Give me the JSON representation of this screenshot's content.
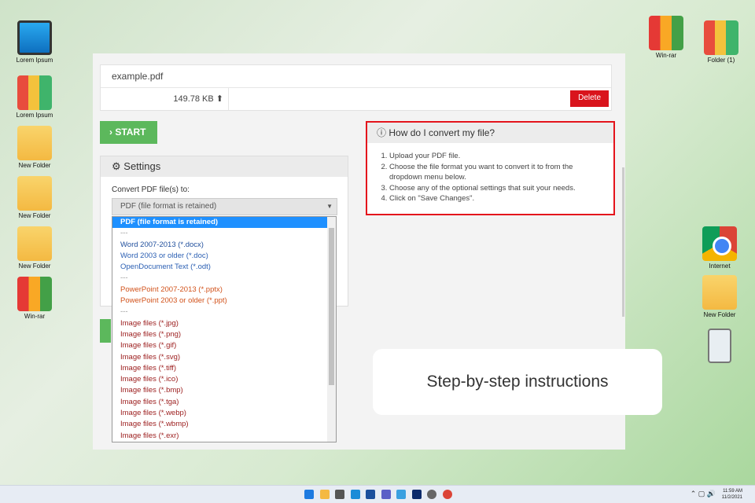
{
  "desktop": {
    "left_icons": [
      {
        "label": "Lorem Ipsum",
        "icon": "computer-icon"
      },
      {
        "label": "Lorem Ipsum",
        "icon": "binders-icon"
      },
      {
        "label": "New Folder",
        "icon": "folder-icon"
      },
      {
        "label": "New Folder",
        "icon": "folder-icon"
      },
      {
        "label": "New Folder",
        "icon": "folder-icon"
      },
      {
        "label": "Win-rar",
        "icon": "winrar-icon"
      }
    ],
    "right_icons": [
      {
        "label": "Win-rar",
        "icon": "winrar-icon"
      },
      {
        "label": "Folder (1)",
        "icon": "binders-icon"
      },
      {
        "label": "Internet",
        "icon": "chrome-icon"
      },
      {
        "label": "New Folder",
        "icon": "folder-icon"
      },
      {
        "label": "",
        "icon": "trash-icon"
      }
    ]
  },
  "file": {
    "name": "example.pdf",
    "size": "149.78 KB",
    "delete_label": "Delete"
  },
  "start_label": "START",
  "settings": {
    "title": "Settings",
    "convert_label": "Convert PDF file(s) to:",
    "selected": "PDF (file format is retained)"
  },
  "help": {
    "title": "How do I convert my file?",
    "steps": [
      "Upload your PDF file.",
      "Choose the file format you want to convert it to from the dropdown menu below.",
      "Choose any of the optional settings that suit your needs.",
      "Click on \"Save Changes\"."
    ]
  },
  "dropdown": {
    "options": [
      {
        "label": "PDF (file format is retained)",
        "color": "#ffffff"
      },
      {
        "label": "---",
        "color": "#999999"
      },
      {
        "label": "Word 2007-2013 (*.docx)",
        "color": "#1f4e9c"
      },
      {
        "label": "Word 2003 or older (*.doc)",
        "color": "#2b5fb3"
      },
      {
        "label": "OpenDocument Text (*.odt)",
        "color": "#2b5fb3"
      },
      {
        "label": "---",
        "color": "#999999"
      },
      {
        "label": "PowerPoint 2007-2013 (*.pptx)",
        "color": "#d2531c"
      },
      {
        "label": "PowerPoint 2003 or older (*.ppt)",
        "color": "#d2531c"
      },
      {
        "label": "---",
        "color": "#999999"
      },
      {
        "label": "Image files (*.jpg)",
        "color": "#9b1c1c"
      },
      {
        "label": "Image files (*.png)",
        "color": "#9b1c1c"
      },
      {
        "label": "Image files (*.gif)",
        "color": "#9b1c1c"
      },
      {
        "label": "Image files (*.svg)",
        "color": "#9b1c1c"
      },
      {
        "label": "Image files (*.tiff)",
        "color": "#9b1c1c"
      },
      {
        "label": "Image files (*.ico)",
        "color": "#9b1c1c"
      },
      {
        "label": "Image files (*.bmp)",
        "color": "#9b1c1c"
      },
      {
        "label": "Image files (*.tga)",
        "color": "#9b1c1c"
      },
      {
        "label": "Image files (*.webp)",
        "color": "#9b1c1c"
      },
      {
        "label": "Image files (*.wbmp)",
        "color": "#9b1c1c"
      },
      {
        "label": "Image files (*.exr)",
        "color": "#9b1c1c"
      }
    ]
  },
  "caption": "Step-by-step instructions",
  "taskbar": {
    "apps": [
      "start-icon",
      "file-explorer-icon",
      "camera-icon",
      "edge-icon",
      "store-icon",
      "teams-icon",
      "photos-icon",
      "app-icon",
      "settings-icon",
      "chrome-icon"
    ],
    "time": "11:59 AM",
    "date": "11/2/2021"
  }
}
